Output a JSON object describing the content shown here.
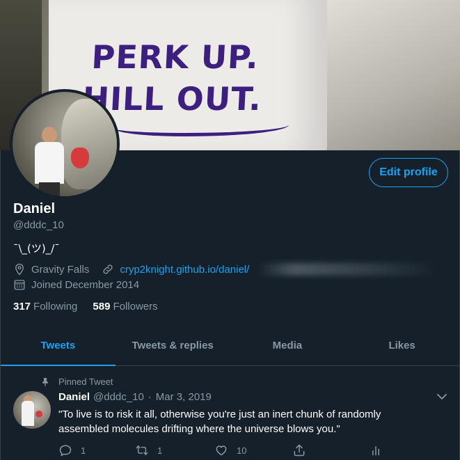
{
  "banner": {
    "line1": "PERK UP.",
    "line2": "HILL OUT."
  },
  "profile": {
    "edit_profile_label": "Edit profile",
    "name": "Daniel",
    "handle": "@dddc_10",
    "bio": "¯\\_(ツ)_/¯",
    "location": "Gravity Falls",
    "website": "cryp2knight.github.io/daniel/",
    "joined": "Joined December 2014",
    "following_count": "317",
    "following_label": "Following",
    "followers_count": "589",
    "followers_label": "Followers"
  },
  "tabs": [
    {
      "label": "Tweets",
      "active": true
    },
    {
      "label": "Tweets & replies",
      "active": false
    },
    {
      "label": "Media",
      "active": false
    },
    {
      "label": "Likes",
      "active": false
    }
  ],
  "tweet": {
    "pinned_label": "Pinned Tweet",
    "name": "Daniel",
    "handle": "@dddc_10",
    "separator": "·",
    "date": "Mar 3, 2019",
    "text": "\"To live is to risk it all, otherwise you're just an inert chunk of randomly assembled molecules drifting where the universe blows you.\"",
    "replies": "1",
    "retweets": "1",
    "likes": "10"
  },
  "colors": {
    "background": "#15202b",
    "accent": "#1da1f2",
    "muted": "#8899a6",
    "border": "#38444d"
  },
  "icons": [
    "location-icon",
    "link-icon",
    "calendar-icon",
    "pin-icon",
    "chevron-down-icon",
    "reply-icon",
    "retweet-icon",
    "like-icon",
    "share-icon",
    "analytics-icon"
  ]
}
